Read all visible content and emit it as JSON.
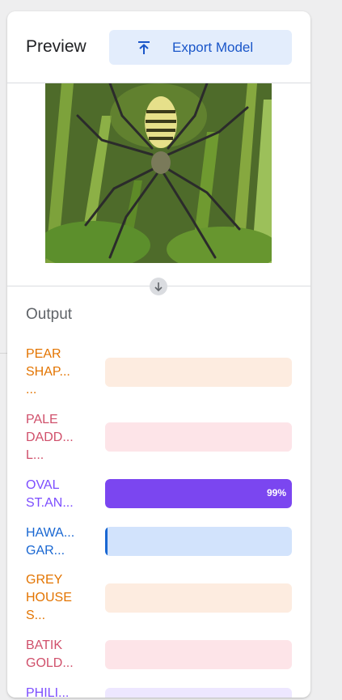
{
  "preview": {
    "title": "Preview",
    "export_button_label": "Export Model",
    "image_alt": "spider on web among green leaves"
  },
  "output": {
    "title": "Output",
    "rows": [
      {
        "label": "PEAR\nSHAP...\n...",
        "text_color": "#e37400",
        "track_color": "#fdece0",
        "fill_color": "#e37400",
        "value": 0,
        "percent_text": ""
      },
      {
        "label": "PALE\nDADD...\nL...",
        "text_color": "#d0506b",
        "track_color": "#fde4e8",
        "fill_color": "#d0506b",
        "value": 0,
        "percent_text": ""
      },
      {
        "label": "OVAL\nST.AN...",
        "text_color": "#7c4dff",
        "track_color": "#ede7ff",
        "fill_color": "#7b46f0",
        "value": 0.99,
        "percent_text": "99%"
      },
      {
        "label": "HAWA...\nGAR...",
        "text_color": "#1967d2",
        "track_color": "#d2e3fc",
        "fill_color": "#1967d2",
        "value": 0.01,
        "percent_text": ""
      },
      {
        "label": "GREY\nHOUSE\nS...",
        "text_color": "#e37400",
        "track_color": "#fdece0",
        "fill_color": "#e37400",
        "value": 0,
        "percent_text": ""
      },
      {
        "label": "BATIK\nGOLD...",
        "text_color": "#d0506b",
        "track_color": "#fde4e8",
        "fill_color": "#d0506b",
        "value": 0,
        "percent_text": ""
      },
      {
        "label": "PHILI...",
        "text_color": "#7c4dff",
        "track_color": "#ede7ff",
        "fill_color": "#7b46f0",
        "value": 0,
        "percent_text": ""
      }
    ]
  }
}
